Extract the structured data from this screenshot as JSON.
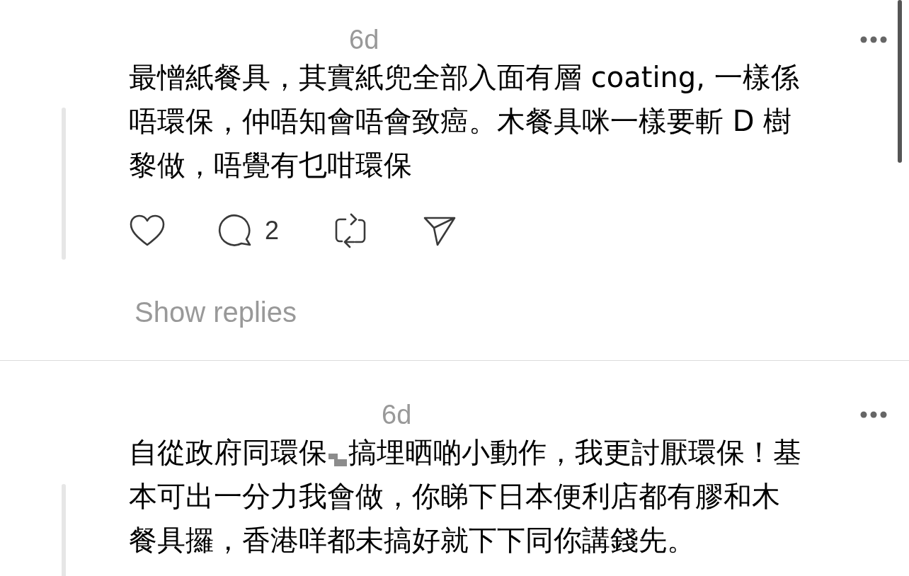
{
  "comments": [
    {
      "time": "6d",
      "lines": [
        [
          {
            "kind": "text",
            "text": "最憎紙餐具，其實紙兜全部入面有層 coating, 一樣係"
          }
        ],
        [
          {
            "kind": "text",
            "text": "唔環保，仲唔知會唔會致癌。木餐具咪一樣要斬 D 樹"
          }
        ],
        [
          {
            "kind": "text",
            "text": "黎做，唔覺有乜咁環保"
          }
        ]
      ],
      "reply_count": "2",
      "show_replies": "Show replies"
    },
    {
      "time": "6d",
      "lines": [
        [
          {
            "kind": "text",
            "text": "自從政府同環保"
          },
          {
            "kind": "redacted"
          },
          {
            "kind": "text",
            "text": "搞埋晒啲小動作，我更討厭環保！基"
          }
        ],
        [
          {
            "kind": "text",
            "text": "本可出一分力我會做，你睇下日本便利店都有膠和木"
          }
        ],
        [
          {
            "kind": "text",
            "text": "餐具攞，香港咩都未搞好就下下同你講錢先。"
          }
        ]
      ]
    }
  ]
}
